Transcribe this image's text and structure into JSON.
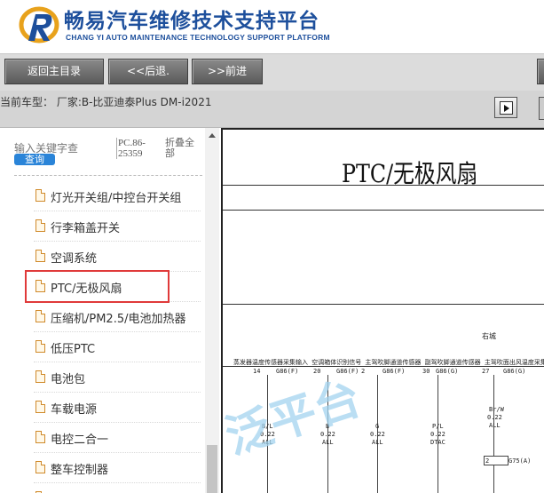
{
  "brand": {
    "title": "畅易汽车维修技术支持平台",
    "subtitle": "CHANG YI AUTO MAINTENANCE TECHNOLOGY SUPPORT PLATFORM",
    "colors": {
      "primary": "#1d4f9c",
      "accent": "#e8a21c"
    }
  },
  "nav": {
    "home_label": "返回主目录",
    "back_label": "<<后退.",
    "forward_label": ">>前进"
  },
  "car": {
    "info": "当前车型：  厂家:B-比亚迪泰Plus DM-i2021"
  },
  "sidebar": {
    "keyword_placeholder": "输入关键字查",
    "query_label": "查询",
    "pc_code": "PC.86-25359",
    "collapse_label": "折叠全部",
    "items": [
      {
        "label": "灯光开关组/中控台开关组"
      },
      {
        "label": "行李箱盖开关"
      },
      {
        "label": "空调系统"
      },
      {
        "label": "PTC/无极风扇",
        "selected": true
      },
      {
        "label": "压缩机/PM2.5/电池加热器"
      },
      {
        "label": "低压PTC"
      },
      {
        "label": "电池包"
      },
      {
        "label": "车载电源"
      },
      {
        "label": "电控二合一"
      },
      {
        "label": "整车控制器"
      }
    ],
    "highlight_color": "#e03a3a"
  },
  "document": {
    "title": "PTC/无极风扇",
    "region_label": "右城",
    "watermark": "泛平台",
    "header_row": "蒸发器温度传感器采集输入  空调箱体识别信号  主驾吹脚通道传感器   副驾吹脚通道传感器  主驾吹面出风温度采集信号 副驾",
    "pins": [
      {
        "pin": "14",
        "conn": "G86(F)",
        "wire": "B/L",
        "gauge": "0.22",
        "option": "ALL"
      },
      {
        "pin": "20",
        "conn": "G86(F)",
        "wire": "B",
        "gauge": "0.22",
        "option": "ALL"
      },
      {
        "pin": "2",
        "conn": "G86(F)",
        "wire": "",
        "gauge": "",
        "option": ""
      },
      {
        "pin": "28",
        "conn": "G86(G)",
        "wire": "G",
        "gauge": "0.22",
        "option": "ALL"
      },
      {
        "pin": "30",
        "conn": "G86(G)",
        "wire": "P/L",
        "gauge": "0.22",
        "option": "DTAC"
      },
      {
        "pin": "27",
        "conn": "G86(G)",
        "wire": "Br/W",
        "gauge": "0.22",
        "option": "ALL"
      }
    ],
    "connector_small": {
      "pin": "2",
      "conn": "G75(A)"
    }
  }
}
